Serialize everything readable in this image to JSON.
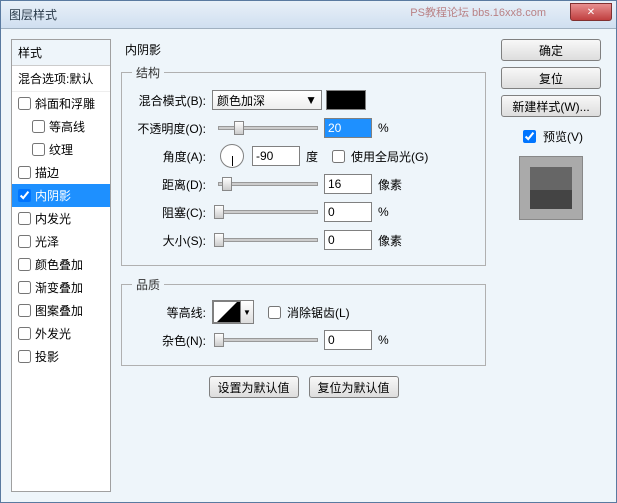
{
  "title": "图层样式",
  "watermark": "PS教程论坛\nbbs.16xx8.com",
  "styles": {
    "header": "样式",
    "sub": "混合选项:默认",
    "items": [
      {
        "label": "斜面和浮雕",
        "checked": false,
        "selected": false,
        "indent": 0
      },
      {
        "label": "等高线",
        "checked": false,
        "selected": false,
        "indent": 1
      },
      {
        "label": "纹理",
        "checked": false,
        "selected": false,
        "indent": 1
      },
      {
        "label": "描边",
        "checked": false,
        "selected": false,
        "indent": 0
      },
      {
        "label": "内阴影",
        "checked": true,
        "selected": true,
        "indent": 0
      },
      {
        "label": "内发光",
        "checked": false,
        "selected": false,
        "indent": 0
      },
      {
        "label": "光泽",
        "checked": false,
        "selected": false,
        "indent": 0
      },
      {
        "label": "颜色叠加",
        "checked": false,
        "selected": false,
        "indent": 0
      },
      {
        "label": "渐变叠加",
        "checked": false,
        "selected": false,
        "indent": 0
      },
      {
        "label": "图案叠加",
        "checked": false,
        "selected": false,
        "indent": 0
      },
      {
        "label": "外发光",
        "checked": false,
        "selected": false,
        "indent": 0
      },
      {
        "label": "投影",
        "checked": false,
        "selected": false,
        "indent": 0
      }
    ]
  },
  "center": {
    "title": "内阴影",
    "structure_legend": "结构",
    "blend_label": "混合模式(B):",
    "blend_value": "颜色加深",
    "opacity_label": "不透明度(O):",
    "opacity_value": "20",
    "opacity_unit": "%",
    "angle_label": "角度(A):",
    "angle_value": "-90",
    "angle_unit": "度",
    "global_light_label": "使用全局光(G)",
    "distance_label": "距离(D):",
    "distance_value": "16",
    "distance_unit": "像素",
    "choke_label": "阻塞(C):",
    "choke_value": "0",
    "choke_unit": "%",
    "size_label": "大小(S):",
    "size_value": "0",
    "size_unit": "像素",
    "quality_legend": "品质",
    "contour_label": "等高线:",
    "antialias_label": "消除锯齿(L)",
    "noise_label": "杂色(N):",
    "noise_value": "0",
    "noise_unit": "%",
    "default_btn": "设置为默认值",
    "reset_btn": "复位为默认值"
  },
  "right": {
    "ok": "确定",
    "cancel": "复位",
    "newstyle": "新建样式(W)...",
    "preview": "预览(V)"
  }
}
